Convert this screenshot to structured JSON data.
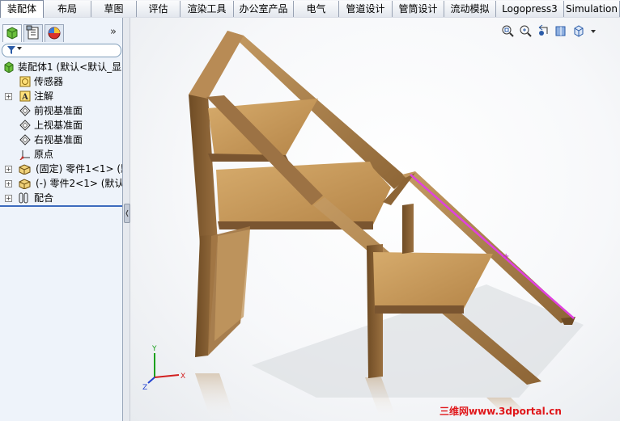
{
  "tabs": [
    {
      "label": "装配体",
      "active": true
    },
    {
      "label": "布局"
    },
    {
      "label": "草图"
    },
    {
      "label": "评估"
    },
    {
      "label": "渲染工具"
    },
    {
      "label": "办公室产品"
    },
    {
      "label": "电气"
    },
    {
      "label": "管道设计"
    },
    {
      "label": "管筒设计"
    },
    {
      "label": "流动模拟"
    },
    {
      "label": "Logopress3"
    },
    {
      "label": "Simulation"
    }
  ],
  "panel": {
    "tab_icons": [
      "feature-manager-icon",
      "property-manager-icon",
      "display-manager-icon"
    ],
    "collapse_glyph": "»",
    "filter_icon": "filter-icon"
  },
  "tree": [
    {
      "label": "装配体1  (默认<默认_显",
      "icon": "assembly-icon",
      "expander": false
    },
    {
      "label": "传感器",
      "icon": "sensor-icon",
      "expander": false
    },
    {
      "label": "注解",
      "icon": "annotation-icon",
      "expander": true
    },
    {
      "label": "前视基准面",
      "icon": "plane-icon",
      "expander": false
    },
    {
      "label": "上视基准面",
      "icon": "plane-icon",
      "expander": false
    },
    {
      "label": "右视基准面",
      "icon": "plane-icon",
      "expander": false
    },
    {
      "label": "原点",
      "icon": "origin-icon",
      "expander": false
    },
    {
      "label": "(固定) 零件1<1> (默",
      "icon": "part-icon",
      "expander": true
    },
    {
      "label": "(-) 零件2<1> (默认",
      "icon": "part-icon",
      "expander": true
    },
    {
      "label": "配合",
      "icon": "mates-icon",
      "expander": true
    }
  ],
  "triad": {
    "x": "X",
    "y": "Y",
    "z": "Z"
  },
  "heads_up_icons": [
    "zoom-to-fit-icon",
    "zoom-area-icon",
    "previous-view-icon",
    "section-view-icon",
    "view-orientation-icon"
  ],
  "watermark": "三维网www.3dportal.cn",
  "colors": {
    "accent": "#3d6bbd",
    "wood": "#a57a47",
    "selection_edge": "#e040e0",
    "watermark": "#e0161a"
  }
}
